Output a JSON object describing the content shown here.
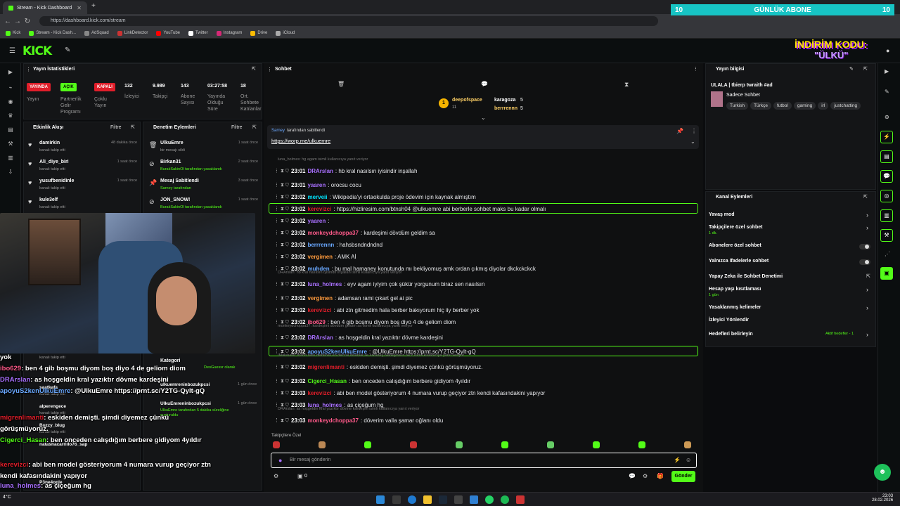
{
  "browser": {
    "tabs": [
      {
        "label": "Stream - Kick Dashboard"
      }
    ],
    "url": "https://dashboard.kick.com/stream",
    "bookmarks": [
      "Kick",
      "Stream - Kick Dash...",
      "AdSquad",
      "LinkDetector",
      "YouTube",
      "Twitter",
      "Instagram",
      "Drive",
      "iCloud"
    ]
  },
  "overlay_banner": {
    "left": "10",
    "title": "GÜNLÜK ABONE",
    "right": "10"
  },
  "promo": {
    "line1": "İNDİRİM KODU:",
    "line2": "\"ÜLKÜ\""
  },
  "stats_panel": {
    "title": "Yayın İstatistikleri",
    "toggles": [
      {
        "badge": "YAYINDA",
        "label": "Yayın",
        "color": "#e01e2a"
      },
      {
        "badge": "AÇIK",
        "label": "Partnerlik Gelir Programı",
        "color": "#53fc18"
      },
      {
        "badge": "KAPALI",
        "label": "Çoklu Yayın",
        "color": "#e01e2a"
      }
    ],
    "stats": [
      {
        "value": "132",
        "label": "İzleyici"
      },
      {
        "value": "9.989",
        "label": "Takipçi"
      },
      {
        "value": "143",
        "label": "Abone Sayısı"
      },
      {
        "value": "03:27:58",
        "label": "Yayında Olduğu Süre"
      },
      {
        "value": "18",
        "label": "Ort. Sohbete Katılanlar"
      }
    ]
  },
  "activity_panel": {
    "title": "Etkinlik Akışı",
    "filter": "Filtre",
    "items": [
      {
        "user": "damirkin",
        "sub": "kanalı takip etti",
        "time": "48 dakika önce"
      },
      {
        "user": "Ali_diye_biri",
        "sub": "kanalı takip etti",
        "time": "1 saat önce"
      },
      {
        "user": "yusufbenidinle",
        "sub": "kanalı takip etti",
        "time": "1 saat önce"
      },
      {
        "user": "kule3elf",
        "sub": "kanalı takip etti",
        "time": ""
      }
    ],
    "bottom_items": [
      {
        "user": "yok",
        "sub": "kanalı takip etti"
      },
      {
        "user": "saatkafa",
        "sub": "kanalı takip etti"
      },
      {
        "user": "alperengece",
        "sub": "kanalı takip etti"
      },
      {
        "user": "Buzzy_blug",
        "sub": "kanalı takip etti"
      },
      {
        "user": "natashacarrillo76_sap",
        "sub": ""
      },
      {
        "user": "P3ne4ople",
        "sub": ""
      }
    ]
  },
  "moderation_panel": {
    "title": "Denetim Eylemleri",
    "filter": "Filtre",
    "items": [
      {
        "user": "UlkuEmre",
        "sub": "bir mesajı sildi",
        "time": "1 saat önce"
      },
      {
        "user": "Birkan31",
        "sub": "BurakSakinOl tarafından yasaklandı",
        "time": "2 saat önce"
      },
      {
        "user": "Mesaj Sabitlendi",
        "sub": "Sarney tarafından",
        "time": "3 saat önce"
      },
      {
        "user": "JON_SNOW!",
        "sub": "BurakSakinOl tarafından yasaklandı",
        "time": "1 saat önce"
      }
    ],
    "bottom_items": [
      {
        "user": "Kategori",
        "sub": "DeoGuessr olarak",
        "time": ""
      },
      {
        "user": "ulkuemreninbozukpcsi",
        "sub": "",
        "time": "1 gün önce"
      },
      {
        "user": "UlkuEmreninbozukpcsi",
        "sub": "UlkuEmre tarafından 5 dakika süreliğine susturuldu",
        "time": "1 gün önce"
      }
    ]
  },
  "chat": {
    "title": "Sohbet",
    "top_gifters": [
      {
        "name": "deepofspace",
        "count": "11"
      },
      {
        "name": "karagoza",
        "count": "5"
      },
      {
        "name": "berrrennn",
        "count": "5"
      }
    ],
    "pinned": {
      "by": "Sarney",
      "by_suffix": "tarafından sabitlendi",
      "link": "https://worp.me/ulkuemre"
    },
    "messages": [
      {
        "reply": "luna_holmes: hg agam isimli kullanıcıya yanıt veriyor",
        "time": "23:01",
        "user": "DRArslan",
        "color": "#a970ff",
        "text": ": hb kral nasılsın iyisindir inşallah"
      },
      {
        "time": "23:01",
        "user": "yaaren",
        "color": "#a970ff",
        "text": ": orocsu cocu"
      },
      {
        "time": "23:02",
        "user": "merveii",
        "color": "#00e5ff",
        "text": ": Wikipedia'yi ortaokulda proje ödevim için kaynak almıştım"
      },
      {
        "time": "23:02",
        "user": "kerevizci",
        "color": "#e01e2a",
        "text": ": https://hizliresim.com/btnsh04 @ulkuemre abi berberle sohbet maks bu kadar olmalı",
        "highlight": true
      },
      {
        "time": "23:02",
        "user": "yaaren",
        "color": "#a970ff",
        "text": ":"
      },
      {
        "time": "23:02",
        "user": "monkeydchoppa37",
        "color": "#ff5a8a",
        "text": ": kardeşimi dövdüm geldim sa"
      },
      {
        "time": "23:02",
        "user": "berrrennn",
        "color": "#6aa8ff",
        "text": ": hahsbsndndndnd"
      },
      {
        "time": "23:02",
        "user": "vergimen",
        "color": "#ff9a3c",
        "text": ": AMK Aİ"
      },
      {
        "time": "23:02",
        "user": "muhden",
        "color": "#6aa8ff",
        "text": ": bu mal hamaney konutunda mı bekliyomuş amk ordan çıkmış diyolar dkckckckck"
      },
      {
        "reply": "DRArslan: hb kral nasılsın iyisindir inşallah isimli kullanıcıya yanıt veriyor",
        "time": "23:02",
        "user": "luna_holmes",
        "color": "#a970ff",
        "text": ": eyv agam iyiyim çok şükür yorgunum biraz sen nasılsın"
      },
      {
        "time": "23:02",
        "user": "vergimen",
        "color": "#ff9a3c",
        "text": ": adamsan rami çıkart gel ai pic"
      },
      {
        "time": "23:02",
        "user": "kerevizci",
        "color": "#e01e2a",
        "text": ": abi ztn gitmedim hala berber bakıyorum hiç iiy berber yok"
      },
      {
        "time": "23:02",
        "user": "ibo629",
        "color": "#ff5a8a",
        "text": ": ben 4 gib boşmu diyom boş diyo 4 de geliom diom"
      },
      {
        "reply": "monkeydchoppa37: kardeşimi dövdüm geldim sa isimli kullanıcıya yanıt veriyor",
        "time": "23:02",
        "user": "DRArslan",
        "color": "#a970ff",
        "text": ": as hoşgeldin kral yazıktır dövme kardeşini"
      },
      {
        "time": "23:02",
        "user": "apoyuS2kenUlkuEmre",
        "color": "#6aa8ff",
        "text": ": @UlkuEmre https://prnt.sc/Y2TG-QyIt-gQ",
        "highlight": true
      },
      {
        "reply": "!Makavelli: mantı nası olabilcek en deccal insanlar ile arkadaş olabiliyosun ne z isimli kullanıcıya yanıt veriyor",
        "time": "23:02",
        "user": "migrenlimanti",
        "color": "#e01e2a",
        "text": ": eskiden demişti. şimdi diyemez çünkü görüşmüyoruz."
      },
      {
        "time": "23:02",
        "user": "Cigerci_Hasan",
        "color": "#53fc18",
        "text": ": ben onceden calışdığım berbere gidiyom 4yıldır"
      },
      {
        "time": "23:03",
        "user": "kerevizci",
        "color": "#e01e2a",
        "text": ": abi ben model gösteriyorum 4 numara vurup geçiyor ztn kendi kafasındakini yapıyor"
      },
      {
        "time": "23:03",
        "user": "luna_holmes",
        "color": "#a970ff",
        "text": ": as çiçeğum hg"
      },
      {
        "reply": "DRArslan: as hoşgeldin kral yazıktır dövme kardeşini isimli kullanıcıya yanıt veriyor",
        "time": "23:03",
        "user": "monkeydchoppa37",
        "color": "#ff5a8a",
        "text": ": döverim valla şamar oğlanı oldu"
      }
    ],
    "emote_label": "Takipçilere Özel",
    "input_placeholder": "Bir mesaj gönderin",
    "send_label": "Gönder",
    "footer_count": "0"
  },
  "stream_info": {
    "title": "Yayın bilgisi",
    "stream_title": "ULALA | tbierp twraith #ad",
    "category": "Sadece Sohbet",
    "tags": [
      "Turkish",
      "Türkçe",
      "futbol",
      "gaming",
      "irl",
      "justchatting"
    ]
  },
  "channel_actions": {
    "title": "Kanal Eylemleri",
    "items": [
      {
        "label": "Yavaş mod",
        "sub": "",
        "control": "chevron"
      },
      {
        "label": "Takipçilere özel sohbet",
        "sub": "1 dk.",
        "control": "chevron"
      },
      {
        "label": "Abonelere özel sohbet",
        "sub": "",
        "control": "toggle"
      },
      {
        "label": "Yalnızca ifadelerle sohbet",
        "sub": "",
        "control": "toggle"
      },
      {
        "label": "Yapay Zeka ile Sohbet Denetimi",
        "sub": "",
        "control": "link"
      },
      {
        "label": "Hesap yaşı kısıtlaması",
        "sub": "1 gün",
        "control": "chevron"
      },
      {
        "label": "Yasaklanmış kelimeler",
        "sub": "",
        "control": "chevron"
      },
      {
        "label": "İzleyici Yönlendir",
        "sub": "",
        "control": "none"
      },
      {
        "label": "Hedefleri belirleyin",
        "sub": "Aktif hedefler - 1",
        "control": "chevron"
      }
    ]
  },
  "overlay_chat": [
    {
      "user": "yok",
      "color": "#ffffff",
      "text": ""
    },
    {
      "user": "ibo629",
      "color": "#ff5a8a",
      "text": ": ben 4 gib boşmu diyom boş diyo 4 de geliom diom"
    },
    {
      "user": "DRArslan",
      "color": "#a970ff",
      "text": ": as hoşgeldin kral yazıktır dövme kardeşini"
    },
    {
      "user": "apoyuS2kenUlkuEmre",
      "color": "#6aa8ff",
      "text": ": @UlkuEmre https://prnt.sc/Y2TG-QyIt-gQ"
    },
    {
      "user": "migrenlimanti",
      "color": "#e01e2a",
      "text": ": eskiden demişti. şimdi diyemez çünkü görüşmüyoruz."
    },
    {
      "user": "Cigerci_Hasan",
      "color": "#53fc18",
      "text": ": ben onceden calışdığım berbere gidiyom 4yıldır"
    },
    {
      "user": "kerevizci",
      "color": "#e01e2a",
      "text": ": abi ben model gösteriyorum 4 numara vurup geçiyor ztn kendi kafasındakini yapıyor"
    },
    {
      "user": "luna_holmes",
      "color": "#a970ff",
      "text": ": as çiçeğum hg"
    },
    {
      "user": "monkeydchoppa37",
      "color": "#ff5a8a",
      "text": ": döverim valla şamar oğlanı oldu"
    }
  ],
  "taskbar": {
    "temp": "4°C",
    "time": "23:03",
    "date": "28.02.2026"
  }
}
